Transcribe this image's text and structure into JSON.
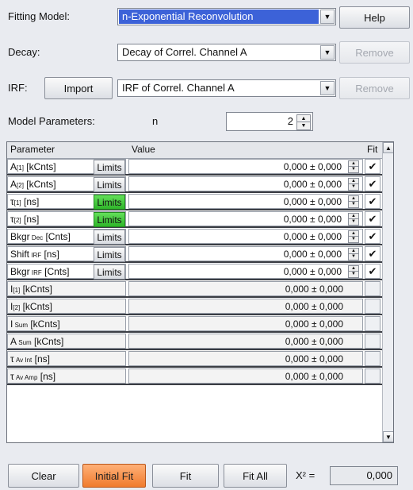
{
  "header": {
    "fitting_model_label": "Fitting Model:",
    "fitting_model_value": "n-Exponential Reconvolution",
    "help_label": "Help",
    "decay_label": "Decay:",
    "decay_value": "Decay of Correl. Channel A",
    "remove_label": "Remove",
    "irf_label": "IRF:",
    "import_label": "Import",
    "irf_value": "IRF of Correl. Channel A",
    "model_params_label": "Model Parameters:",
    "n_label": "n",
    "n_value": "2"
  },
  "table": {
    "headers": {
      "parameter": "Parameter",
      "value": "Value",
      "fit": "Fit"
    },
    "rows": [
      {
        "main": "A",
        "sub": "[1]",
        "tail": " [kCnts]",
        "limits": "Limits",
        "limits_green": false,
        "value": "0,000 ± 0,000",
        "fit": "✔",
        "editable": true
      },
      {
        "main": "A",
        "sub": "[2]",
        "tail": " [kCnts]",
        "limits": "Limits",
        "limits_green": false,
        "value": "0,000 ± 0,000",
        "fit": "✔",
        "editable": true
      },
      {
        "main": "τ",
        "sub": "[1]",
        "tail": " [ns]",
        "limits": "Limits",
        "limits_green": true,
        "value": "0,000 ± 0,000",
        "fit": "✔",
        "editable": true
      },
      {
        "main": "τ",
        "sub": "[2]",
        "tail": " [ns]",
        "limits": "Limits",
        "limits_green": true,
        "value": "0,000 ± 0,000",
        "fit": "✔",
        "editable": true
      },
      {
        "main": "Bkgr",
        "sub": " Dec",
        "tail": " [Cnts]",
        "limits": "Limits",
        "limits_green": false,
        "value": "0,000 ± 0,000",
        "fit": "✔",
        "editable": true
      },
      {
        "main": "Shift",
        "sub": " IRF",
        "tail": " [ns]",
        "limits": "Limits",
        "limits_green": false,
        "value": "0,000 ± 0,000",
        "fit": "✔",
        "editable": true
      },
      {
        "main": "Bkgr",
        "sub": " IRF",
        "tail": " [Cnts]",
        "limits": "Limits",
        "limits_green": false,
        "value": "0,000 ± 0,000",
        "fit": "✔",
        "editable": true
      },
      {
        "main": "I",
        "sub": "[1]",
        "tail": " [kCnts]",
        "limits": "",
        "limits_green": false,
        "value": "0,000 ± 0,000",
        "fit": "",
        "editable": false
      },
      {
        "main": "I",
        "sub": "[2]",
        "tail": " [kCnts]",
        "limits": "",
        "limits_green": false,
        "value": "0,000 ± 0,000",
        "fit": "",
        "editable": false
      },
      {
        "main": "I",
        "sub": " Sum",
        "tail": " [kCnts]",
        "limits": "",
        "limits_green": false,
        "value": "0,000 ± 0,000",
        "fit": "",
        "editable": false
      },
      {
        "main": "A",
        "sub": " Sum",
        "tail": " [kCnts]",
        "limits": "",
        "limits_green": false,
        "value": "0,000 ± 0,000",
        "fit": "",
        "editable": false
      },
      {
        "main": "τ",
        "sub": " Av Int",
        "tail": " [ns]",
        "limits": "",
        "limits_green": false,
        "value": "0,000 ± 0,000",
        "fit": "",
        "editable": false
      },
      {
        "main": "τ",
        "sub": " Av Amp",
        "tail": " [ns]",
        "limits": "",
        "limits_green": false,
        "value": "0,000 ± 0,000",
        "fit": "",
        "editable": false
      }
    ]
  },
  "footer": {
    "clear_label": "Clear",
    "initial_fit_label": "Initial Fit",
    "fit_label": "Fit",
    "fit_all_label": "Fit All",
    "chi2_label": "X² =",
    "chi2_value": "0,000"
  },
  "colors": {
    "selection": "#3c62d8",
    "initial_fit_button": "#f07b2e",
    "limits_active": "#2fb62a"
  },
  "icons": {
    "combo_arrow": "chevron-down-icon",
    "spinner": "spinner-icon",
    "fit_check": "checkmark-icon"
  }
}
